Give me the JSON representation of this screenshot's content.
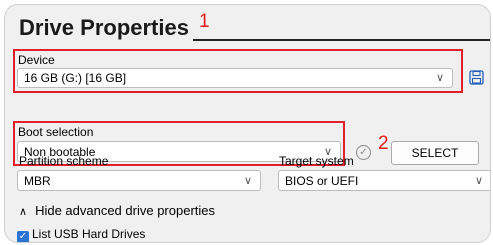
{
  "section": {
    "title": "Drive Properties",
    "annotation_1": "1",
    "annotation_2": "2"
  },
  "device": {
    "label": "Device",
    "value": "16 GB (G:) [16 GB]",
    "save_icon": "floppy-disk-icon"
  },
  "boot": {
    "label": "Boot selection",
    "value": "Non bootable",
    "verify_icon": "checkmark-circle-icon",
    "select_button": "SELECT"
  },
  "partition": {
    "label": "Partition scheme",
    "value": "MBR"
  },
  "target": {
    "label": "Target system",
    "value": "BIOS or UEFI"
  },
  "advanced": {
    "toggle_label": "Hide advanced drive properties",
    "list_usb_label": "List USB Hard Drives",
    "list_usb_checked": true
  },
  "colors": {
    "annotation_red": "#e21b1b",
    "checkbox_blue": "#2b74d6"
  }
}
